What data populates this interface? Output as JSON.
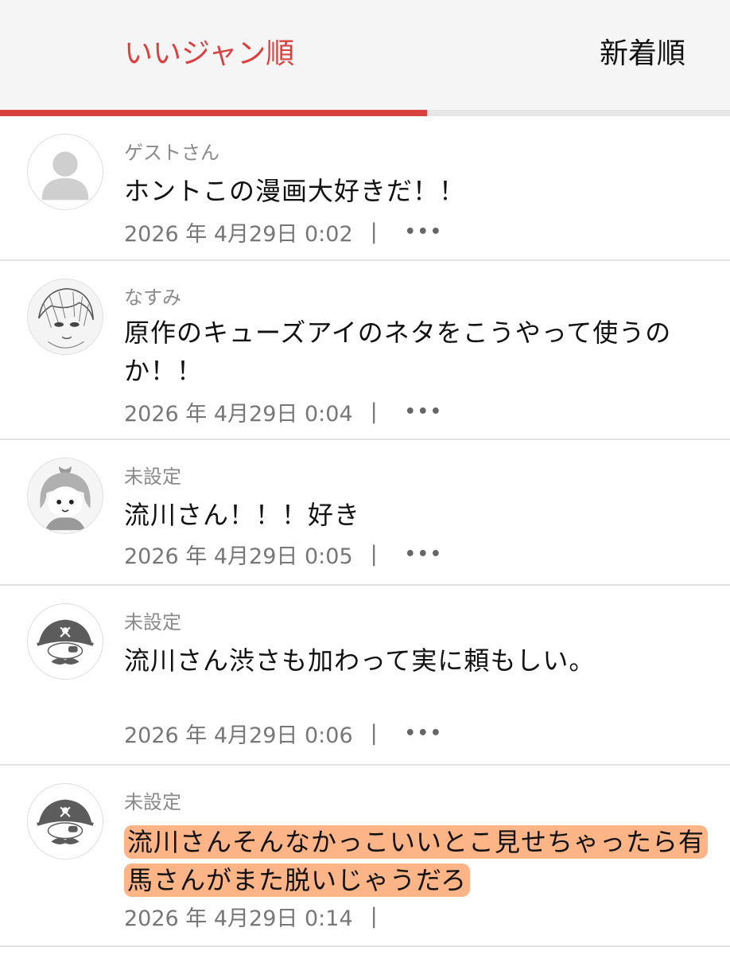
{
  "tabs": {
    "popular_label": "いいジャン順",
    "newest_label": "新着順",
    "active_color": "#d9413f",
    "active_progress": 0.585
  },
  "comments": [
    {
      "avatar_icon": "default-user-icon",
      "name": "ゲストさん",
      "text": "ホントこの漫画大好きだ！！",
      "date": "2026 年 4月29日 0:02",
      "separator": "|",
      "more": "•••"
    },
    {
      "avatar_icon": "manga-character-avatar",
      "name": "なすみ",
      "text": "原作のキューズアイのネタをこうやって使うのか！！",
      "date": "2026 年 4月29日 0:04",
      "separator": "|",
      "more": "•••"
    },
    {
      "avatar_icon": "girl-with-bow-avatar",
      "name": "未設定",
      "text": "流川さん！！！好き",
      "date": "2026 年 4月29日 0:05",
      "separator": "|",
      "more": "•••"
    },
    {
      "avatar_icon": "pirate-icon",
      "name": "未設定",
      "text": "流川さん渋さも加わって実に頼もしい。",
      "date": "2026 年 4月29日 0:06",
      "separator": "|",
      "more": "•••"
    },
    {
      "avatar_icon": "pirate-icon",
      "name": "未設定",
      "text": "流川さんそんなかっこいいとこ見せちゃったら有馬さんがまた脱いじゃうだろ",
      "date": "2026 年 4月29日 0:14",
      "separator": "|",
      "highlight_color": "#fdb486"
    }
  ]
}
